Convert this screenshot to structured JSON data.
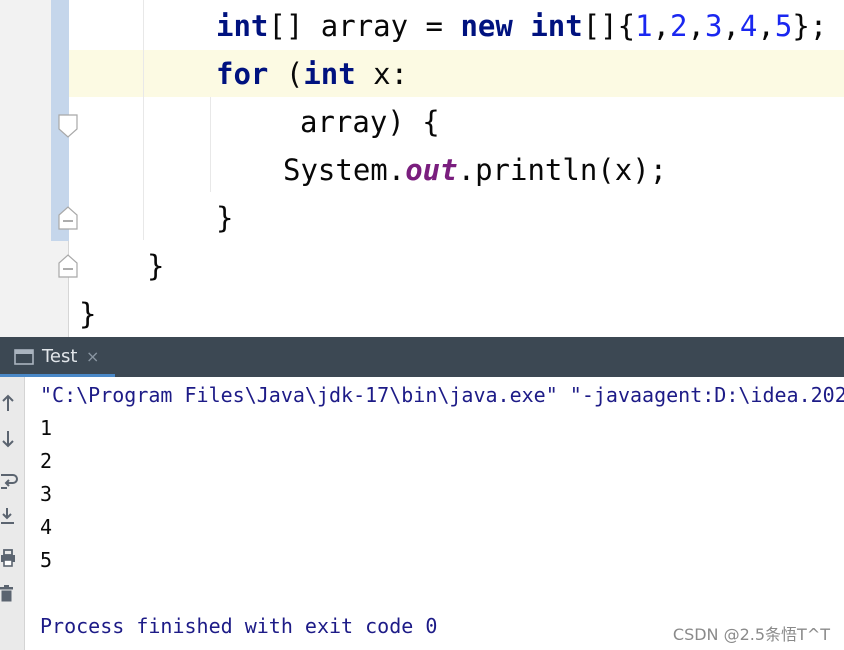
{
  "editor": {
    "lines": [
      {
        "parts": [
          {
            "t": "int",
            "c": "kw"
          },
          {
            "t": "[] array = ",
            "c": ""
          },
          {
            "t": "new",
            "c": "kw"
          },
          {
            "t": " ",
            "c": ""
          },
          {
            "t": "int",
            "c": "kw"
          },
          {
            "t": "[]{",
            "c": ""
          },
          {
            "t": "1",
            "c": "num"
          },
          {
            "t": ",",
            "c": ""
          },
          {
            "t": "2",
            "c": "num"
          },
          {
            "t": ",",
            "c": ""
          },
          {
            "t": "3",
            "c": "num"
          },
          {
            "t": ",",
            "c": ""
          },
          {
            "t": "4",
            "c": "num"
          },
          {
            "t": ",",
            "c": ""
          },
          {
            "t": "5",
            "c": "num"
          },
          {
            "t": "};",
            "c": ""
          }
        ]
      },
      {
        "parts": [
          {
            "t": "for",
            "c": "kw"
          },
          {
            "t": " (",
            "c": ""
          },
          {
            "t": "int",
            "c": "kw"
          },
          {
            "t": " x:",
            "c": ""
          }
        ]
      },
      {
        "parts": [
          {
            "t": "array) {",
            "c": ""
          }
        ]
      },
      {
        "parts": [
          {
            "t": "System.",
            "c": ""
          },
          {
            "t": "out",
            "c": "field"
          },
          {
            "t": ".println(x);",
            "c": ""
          }
        ]
      },
      {
        "parts": [
          {
            "t": "}",
            "c": ""
          }
        ]
      },
      {
        "parts": [
          {
            "t": "}",
            "c": ""
          }
        ]
      },
      {
        "parts": [
          {
            "t": "}",
            "c": ""
          }
        ]
      }
    ]
  },
  "run_panel": {
    "tab_label": "Test",
    "tab_close": "×",
    "toolbar": [
      "up-arrow-icon",
      "down-arrow-icon",
      "soft-wrap-icon",
      "scroll-to-end-icon",
      "print-icon",
      "trash-icon"
    ],
    "console_lines": [
      "\"C:\\Program Files\\Java\\jdk-17\\bin\\java.exe\" \"-javaagent:D:\\idea.202",
      "1",
      "2",
      "3",
      "4",
      "5",
      "",
      "Process finished with exit code 0"
    ]
  },
  "watermark": "CSDN @2.5条悟T^T",
  "colors": {
    "keyword": "#00127f",
    "number": "#1a27f0",
    "static_field": "#7a1e7e",
    "console_system": "#1d1b87",
    "tool_window_header": "#3c4853",
    "tab_underline": "#4a88c7",
    "current_line": "#fcfae3",
    "gutter_bar": "#c5d6eb"
  }
}
